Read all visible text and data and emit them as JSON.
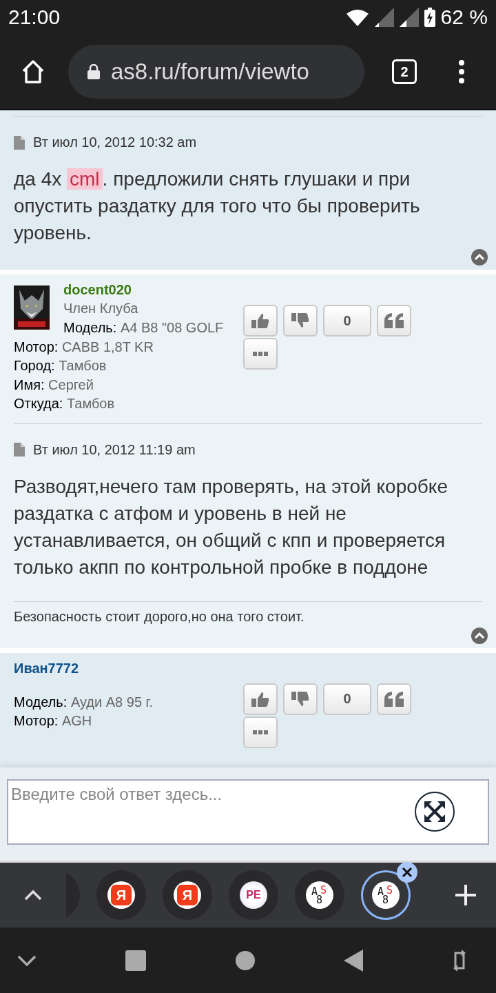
{
  "status_bar": {
    "time": "21:00",
    "battery": "62 %"
  },
  "browser": {
    "url": "as8.ru/forum/viewto",
    "tab_count": "2"
  },
  "posts": [
    {
      "date": "Вт июл 10, 2012 10:32 am",
      "body": [
        {
          "text": "да 4х ",
          "highlight": false
        },
        {
          "text": "cml",
          "highlight": true
        },
        {
          "text": ". предложили снять глушаки и при опустить раздатку для того что бы проверить уровень.",
          "highlight": false
        }
      ]
    },
    {
      "author": {
        "name": "docent020",
        "color": "#3a7a10",
        "rank": "Член Клуба",
        "fields": [
          {
            "label": "Модель:",
            "value": "A4 B8 \"08 GOLF"
          },
          {
            "label": "Мотор:",
            "value": "CABB 1,8T KR"
          },
          {
            "label": "Город:",
            "value": "Тамбов"
          },
          {
            "label": "Имя:",
            "value": "Сергей"
          },
          {
            "label": "Откуда:",
            "value": "Тамбов"
          }
        ]
      },
      "votes": "0",
      "date": "Вт июл 10, 2012 11:19 am",
      "body": [
        {
          "text": "Разводят,нечего там проверять, на этой коробке раздатка с атфом и уровень в ней не устанавливается, он общий с кпп и проверяется только акпп по контрольной пробке в поддоне",
          "highlight": false
        }
      ],
      "signature": "Безопасность стоит дорого,но она того стоит."
    },
    {
      "author": {
        "name": "Иван7772",
        "color": "#105289",
        "fields": [
          {
            "label": "Модель:",
            "value": "Ауди A8 95 г."
          },
          {
            "label": "Мотор:",
            "value": "AGH"
          }
        ]
      },
      "votes": "0"
    }
  ],
  "reply": {
    "placeholder": "Введите свой ответ здесь..."
  },
  "tabs": [
    {
      "kind": "partial",
      "selected": false
    },
    {
      "kind": "yandex",
      "favicon": "Я",
      "selected": false
    },
    {
      "kind": "yandex",
      "favicon": "Я",
      "selected": false
    },
    {
      "kind": "pe",
      "favicon": "PE",
      "selected": false
    },
    {
      "kind": "as8",
      "favicon": "AS8",
      "selected": false
    },
    {
      "kind": "as8",
      "favicon": "AS8",
      "selected": true
    }
  ]
}
